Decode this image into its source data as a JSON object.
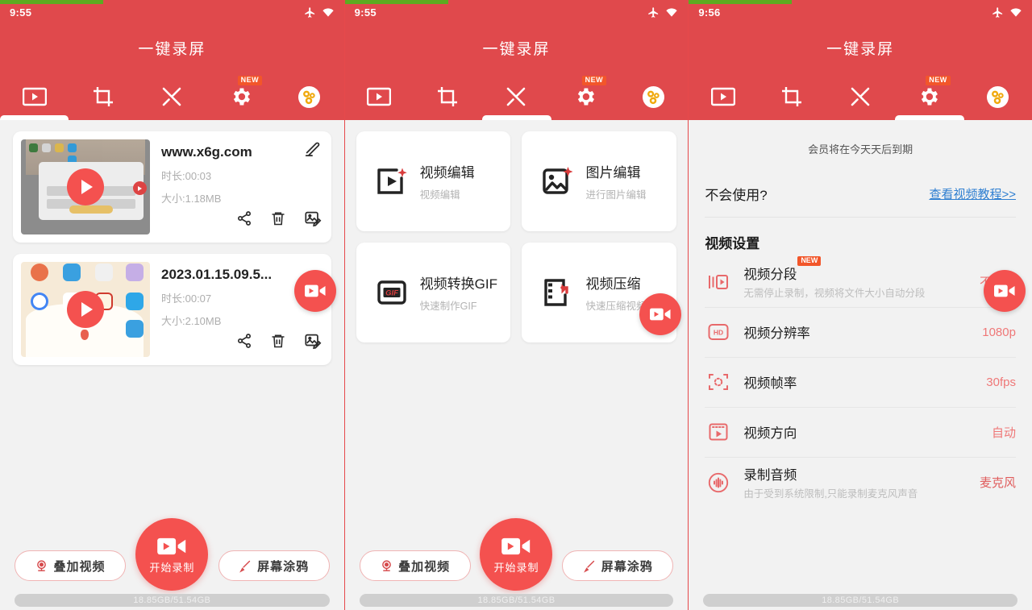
{
  "app": {
    "title": "一键录屏",
    "accent": "#e0494c",
    "fab_color": "#f4514f",
    "bg": "#f2f2f2"
  },
  "screens": [
    {
      "status": {
        "time": "9:55",
        "icons": [
          "airplane-icon",
          "wifi-icon"
        ]
      },
      "tabs": [
        {
          "name": "video",
          "icon": "film-video-icon",
          "badge": ""
        },
        {
          "name": "crop",
          "icon": "crop-icon",
          "badge": ""
        },
        {
          "name": "tools",
          "icon": "tools-icon",
          "badge": ""
        },
        {
          "name": "settings",
          "icon": "gear-icon",
          "badge": "NEW"
        },
        {
          "name": "member",
          "icon": "coins-icon",
          "badge": ""
        }
      ],
      "active_tab": 0
    },
    {
      "status": {
        "time": "9:55",
        "icons": [
          "airplane-icon",
          "wifi-icon"
        ]
      },
      "tabs": [
        {
          "name": "video",
          "icon": "film-video-icon",
          "badge": ""
        },
        {
          "name": "crop",
          "icon": "crop-icon",
          "badge": ""
        },
        {
          "name": "tools",
          "icon": "tools-icon",
          "badge": ""
        },
        {
          "name": "settings",
          "icon": "gear-icon",
          "badge": "NEW"
        },
        {
          "name": "member",
          "icon": "coins-icon",
          "badge": ""
        }
      ],
      "active_tab": 2
    },
    {
      "status": {
        "time": "9:56",
        "icons": [
          "airplane-icon",
          "wifi-icon"
        ]
      },
      "tabs": [
        {
          "name": "video",
          "icon": "film-video-icon",
          "badge": ""
        },
        {
          "name": "crop",
          "icon": "crop-icon",
          "badge": ""
        },
        {
          "name": "tools",
          "icon": "tools-icon",
          "badge": ""
        },
        {
          "name": "settings",
          "icon": "gear-icon",
          "badge": "NEW"
        },
        {
          "name": "member",
          "icon": "coins-icon",
          "badge": ""
        }
      ],
      "active_tab": 3
    }
  ],
  "videos": [
    {
      "title": "www.x6g.com",
      "duration": "时长:00:03",
      "size": "大小:1.18MB",
      "actions": [
        "share-icon",
        "trash-icon",
        "image-edit-icon"
      ],
      "has_edit_pen": true
    },
    {
      "title": "2023.01.15.09.5...",
      "duration": "时长:00:07",
      "size": "大小:2.10MB",
      "actions": [
        "share-icon",
        "trash-icon",
        "image-edit-icon"
      ],
      "has_edit_pen": false
    }
  ],
  "tools": [
    {
      "icon": "video-edit-icon",
      "title": "视频编辑",
      "sub": "视频编辑"
    },
    {
      "icon": "image-edit-plus-icon",
      "title": "图片编辑",
      "sub": "进行图片编辑"
    },
    {
      "icon": "gif-icon",
      "title": "视频转换GIF",
      "sub": "快速制作GIF"
    },
    {
      "icon": "video-compress-icon",
      "title": "视频压缩",
      "sub": "快速压缩视频"
    }
  ],
  "bottom": {
    "overlay_label": "叠加视频",
    "overlay_icon": "camera-overlay-icon",
    "record_label": "开始录制",
    "record_icon": "video-camera-icon",
    "doodle_label": "屏幕涂鸦",
    "doodle_icon": "brush-icon",
    "storage": "18.85GB/51.54GB"
  },
  "settings": {
    "member_note": "会员将在今天天后到期",
    "help_question": "不会使用?",
    "help_link": "查看视频教程>>",
    "section_title": "视频设置",
    "rows": [
      {
        "icon": "segment-icon",
        "label": "视频分段",
        "badge": "NEW",
        "desc": "无需停止录制，视频将文件大小自动分段",
        "value": "不分段"
      },
      {
        "icon": "hd-icon",
        "label": "视频分辨率",
        "badge": "",
        "desc": "",
        "value": "1080p"
      },
      {
        "icon": "framerate-icon",
        "label": "视频帧率",
        "badge": "",
        "desc": "",
        "value": "30fps"
      },
      {
        "icon": "orientation-icon",
        "label": "视频方向",
        "badge": "",
        "desc": "",
        "value": "自动"
      },
      {
        "icon": "audio-wave-icon",
        "label": "录制音频",
        "badge": "",
        "desc": "由于受到系统限制,只能录制麦克风声音",
        "value": "麦克风"
      }
    ]
  }
}
